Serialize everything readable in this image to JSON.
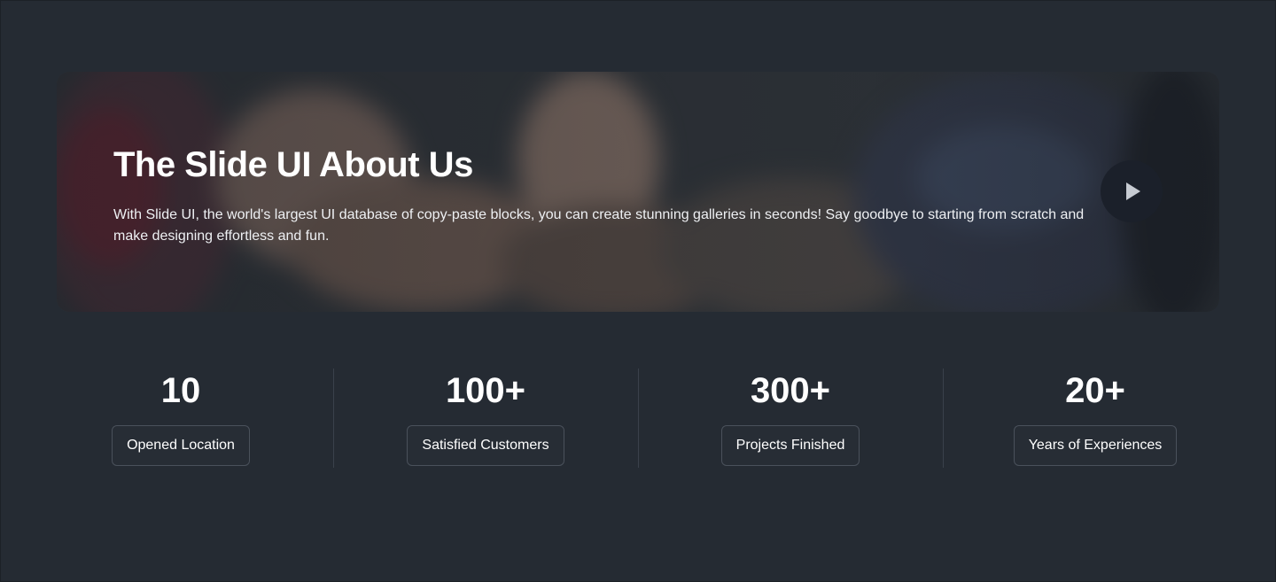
{
  "hero": {
    "title": "The Slide UI About Us",
    "description": "With Slide UI, the world's largest UI database of copy-paste blocks, you can create stunning galleries in seconds! Say goodbye to starting from scratch and make designing effortless and fun.",
    "background_image": "blurred-photo-hands-and-laptop",
    "play_icon": "play-icon"
  },
  "stats": [
    {
      "value": "10",
      "label": "Opened Location"
    },
    {
      "value": "100+",
      "label": "Satisfied Customers"
    },
    {
      "value": "300+",
      "label": "Projects Finished"
    },
    {
      "value": "20+",
      "label": "Years of Experiences"
    }
  ],
  "colors": {
    "page_background": "#252b33",
    "play_button": "#1b202a",
    "divider": "#3a414b",
    "label_border": "#4a515b"
  }
}
